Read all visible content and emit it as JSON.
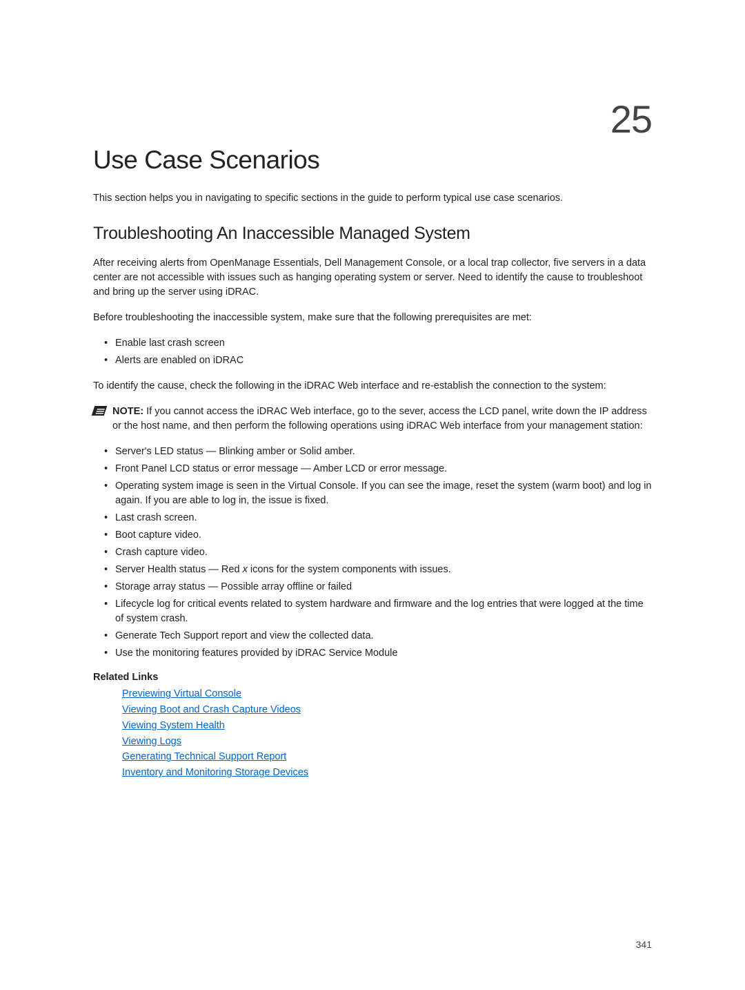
{
  "chapter": "25",
  "title": "Use Case Scenarios",
  "intro": "This section helps you in navigating to specific sections in the guide to perform typical use case scenarios.",
  "section_heading": "Troubleshooting An Inaccessible Managed System",
  "para1": "After receiving alerts from OpenManage Essentials, Dell Management Console, or a local trap collector, five servers in a data center are not accessible with issues such as hanging operating system or server. Need to identify the cause to troubleshoot and bring up the server using iDRAC.",
  "para2": "Before troubleshooting the inaccessible system, make sure that the following prerequisites are met:",
  "prereqs": [
    "Enable last crash screen",
    "Alerts are enabled on iDRAC"
  ],
  "para3": "To identify the cause, check the following in the iDRAC Web interface and re-establish the connection to the system:",
  "note_label": "NOTE: ",
  "note_text": "If you cannot access the iDRAC Web interface, go to the sever, access the LCD panel, write down the IP address or the host name, and then perform the following operations using iDRAC Web interface from your management station:",
  "checks": [
    "Server's LED status — Blinking amber or Solid amber.",
    "Front Panel LCD status or error message — Amber LCD or error message.",
    "Operating system image is seen in the Virtual Console. If you can see the image, reset the system (warm boot) and log in again. If you are able to log in, the issue is fixed.",
    "Last crash screen.",
    "Boot capture video.",
    "Crash capture video.",
    "Server Health status — Red x icons for the system components with issues.",
    "Storage array status — Possible array offline or failed",
    "Lifecycle log for critical events related to system hardware and firmware and the log entries that were logged at the time of system crash.",
    "Generate Tech Support report and view the collected data.",
    "Use the monitoring features provided by iDRAC Service Module"
  ],
  "related_heading": "Related Links",
  "related_links": [
    "Previewing Virtual Console",
    "Viewing Boot and Crash Capture Videos",
    "Viewing System Health",
    "Viewing Logs",
    "Generating Technical Support Report",
    "Inventory and Monitoring Storage Devices"
  ],
  "page_number": "341"
}
